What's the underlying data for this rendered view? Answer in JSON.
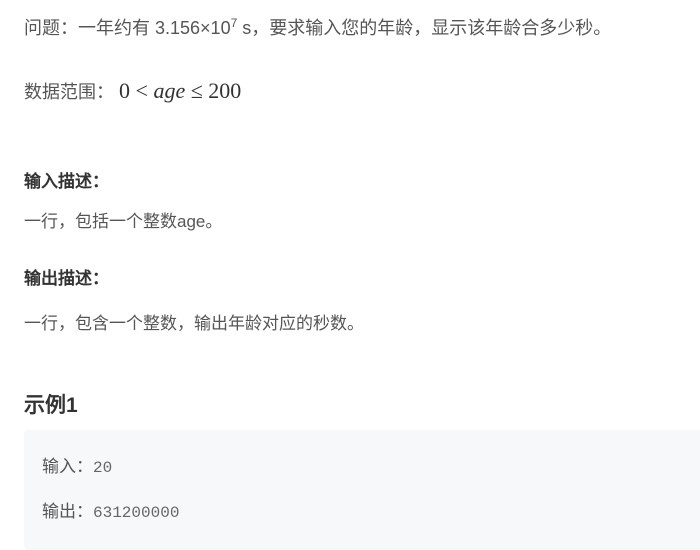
{
  "problem": {
    "prefix": "问题：一年约有 3.156×10",
    "exponent": "7",
    "suffix": " s，要求输入您的年龄，显示该年龄合多少秒。"
  },
  "range": {
    "label": "数据范围：",
    "lower": "0",
    "lt": "<",
    "var": "age",
    "le": "≤",
    "upper": "200"
  },
  "input_desc": {
    "title": "输入描述：",
    "text": "一行，包括一个整数age。"
  },
  "output_desc": {
    "title": "输出描述：",
    "text": "一行，包含一个整数，输出年龄对应的秒数。"
  },
  "example": {
    "title": "示例1",
    "input_label": "输入：",
    "input_value": "20",
    "output_label": "输出：",
    "output_value": "631200000"
  }
}
